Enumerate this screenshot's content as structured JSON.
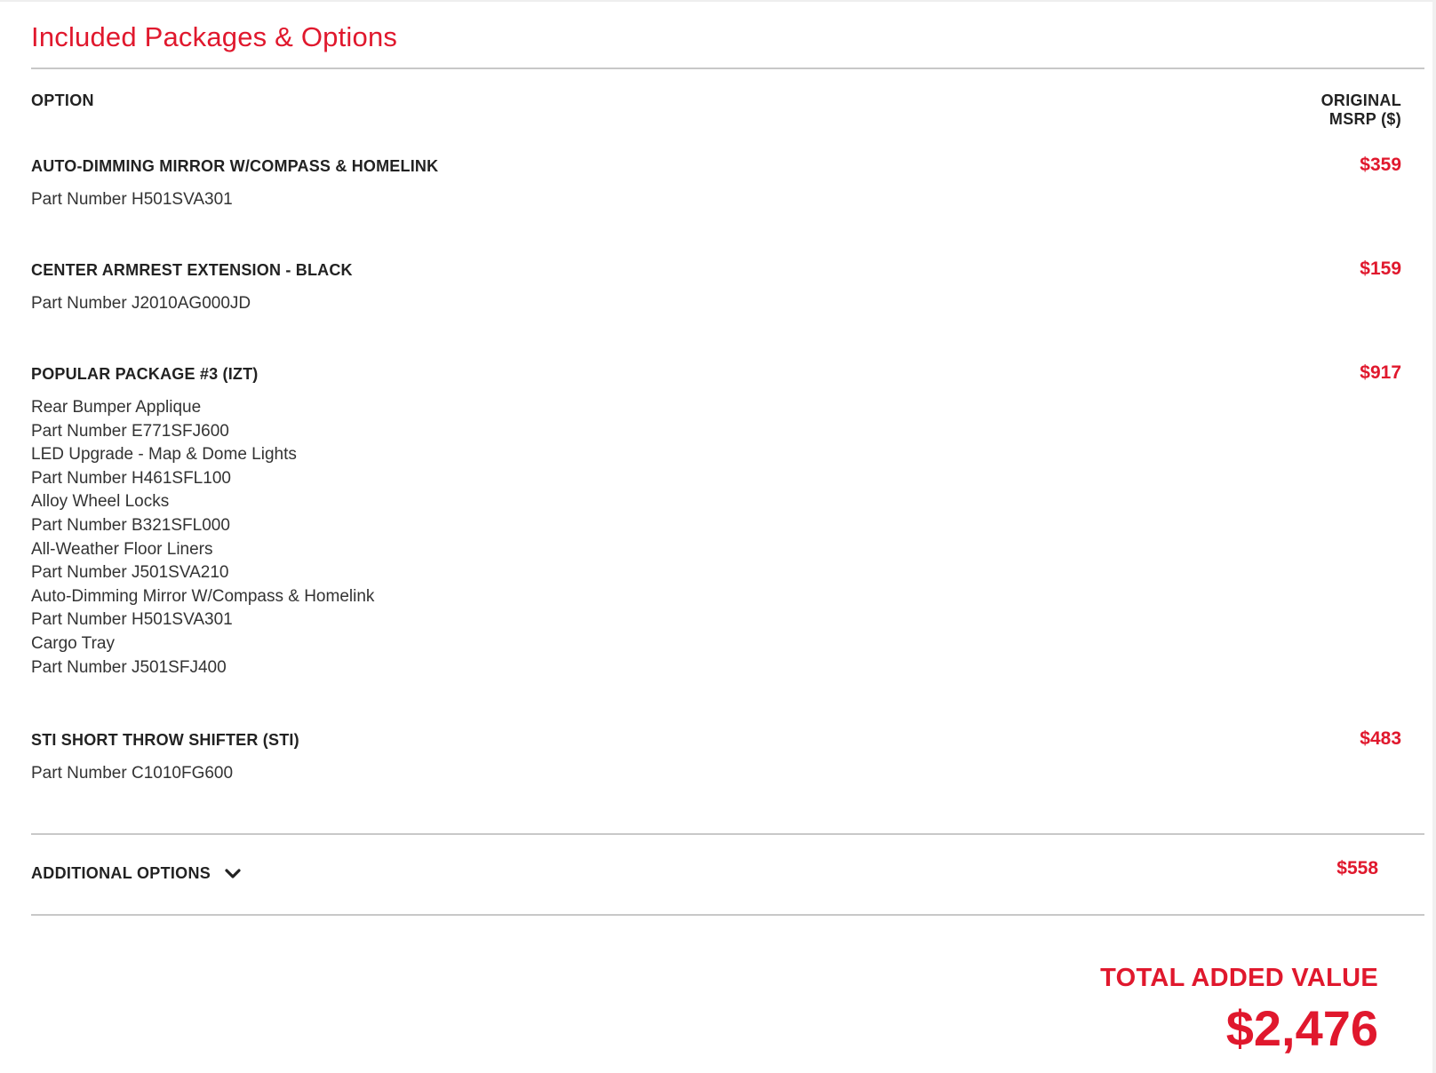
{
  "section": {
    "title": "Included Packages & Options"
  },
  "table_header": {
    "option_label": "OPTION",
    "price_label_line1": "ORIGINAL",
    "price_label_line2": "MSRP ($)"
  },
  "options": [
    {
      "name": "AUTO-DIMMING MIRROR W/COMPASS & HOMELINK",
      "price": "$359",
      "lines": [
        "Part Number H501SVA301"
      ]
    },
    {
      "name": "CENTER ARMREST EXTENSION - BLACK",
      "price": "$159",
      "lines": [
        "Part Number J2010AG000JD"
      ]
    },
    {
      "name": "POPULAR PACKAGE #3 (IZT)",
      "price": "$917",
      "lines": [
        "Rear Bumper Applique",
        "Part Number E771SFJ600",
        "LED Upgrade - Map & Dome Lights",
        "Part Number H461SFL100",
        "Alloy Wheel Locks",
        "Part Number B321SFL000",
        "All-Weather Floor Liners",
        "Part Number J501SVA210",
        "Auto-Dimming Mirror W/Compass & Homelink",
        "Part Number H501SVA301",
        "Cargo Tray",
        "Part Number J501SFJ400"
      ]
    },
    {
      "name": "STI SHORT THROW SHIFTER (STI)",
      "price": "$483",
      "lines": [
        "Part Number C1010FG600"
      ]
    }
  ],
  "additional_options": {
    "label": "ADDITIONAL OPTIONS",
    "icon": "chevron-down-icon",
    "price": "$558"
  },
  "total": {
    "label": "TOTAL ADDED VALUE",
    "value": "$2,476"
  },
  "colors": {
    "accent": "#e0182d",
    "text": "#222222",
    "rule": "#c8c8c8"
  }
}
